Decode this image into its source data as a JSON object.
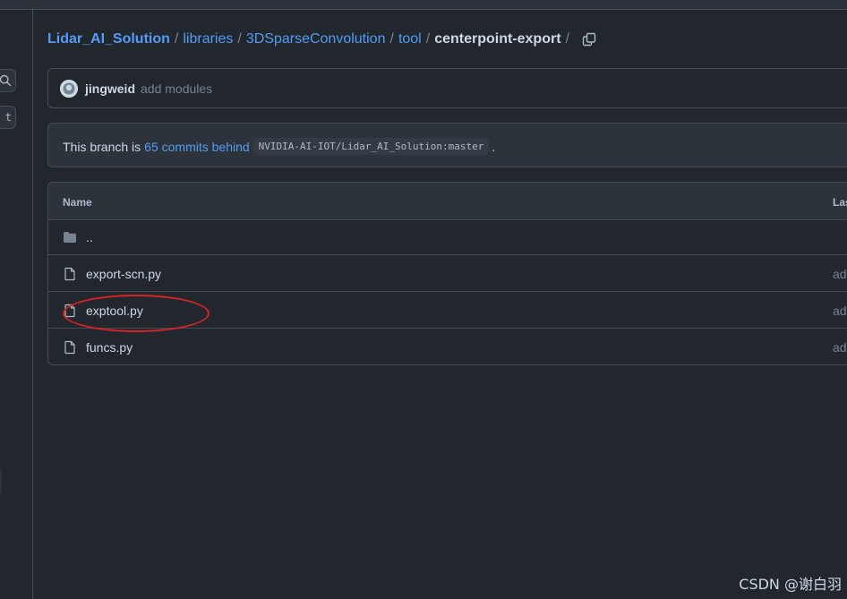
{
  "breadcrumb": {
    "items": [
      "Lidar_AI_Solution",
      "libraries",
      "3DSparseConvolution",
      "tool"
    ],
    "current": "centerpoint-export",
    "separator": "/"
  },
  "sidebar": {
    "search_icon": "search-icon",
    "button_text": "t"
  },
  "commit": {
    "author": "jingweid",
    "message": "add modules"
  },
  "branch": {
    "prefix": "This branch is",
    "link": "65 commits behind",
    "ref": "NVIDIA-AI-IOT/Lidar_AI_Solution:master",
    "suffix": "."
  },
  "table": {
    "headers": {
      "name": "Name",
      "last": "Las"
    },
    "rows": [
      {
        "name": "..",
        "type": "folder",
        "commit": ""
      },
      {
        "name": "export-scn.py",
        "type": "file",
        "commit": "add"
      },
      {
        "name": "exptool.py",
        "type": "file",
        "commit": "add"
      },
      {
        "name": "funcs.py",
        "type": "file",
        "commit": "add"
      }
    ]
  },
  "colors": {
    "link": "#539bf5",
    "highlight": "#d42323",
    "background": "#22272e"
  },
  "watermark": "CSDN @谢白羽"
}
